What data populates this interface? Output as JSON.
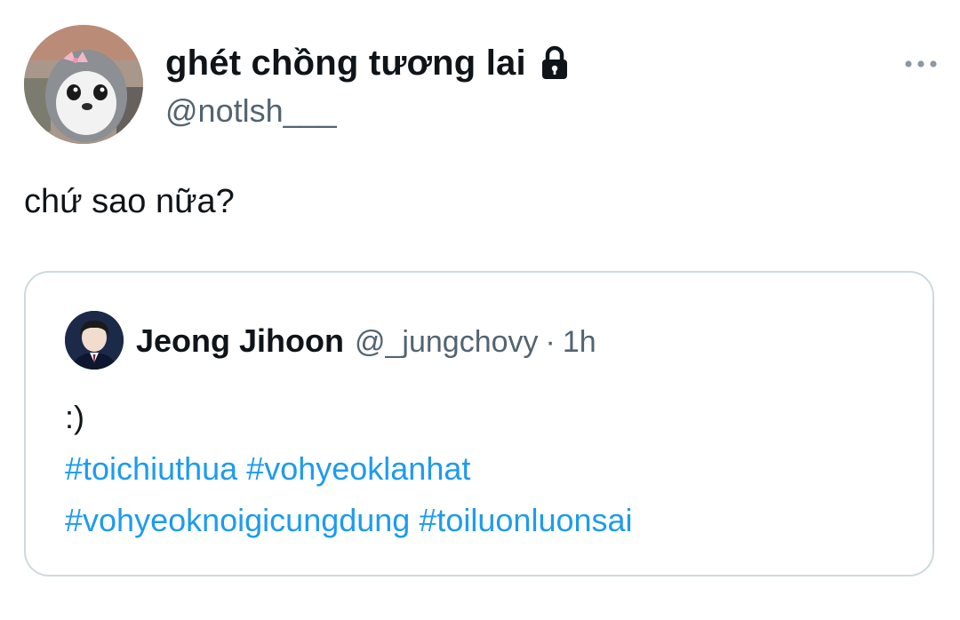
{
  "author": {
    "display_name": "ghét chồng tương lai",
    "handle": "@notlsh___",
    "avatar_icon": "penguin-avatar",
    "protected_icon": "lock-icon"
  },
  "menu_icon": "more-horizontal-icon",
  "tweet_text": "chứ sao nữa?",
  "quoted_tweet": {
    "display_name": "Jeong Jihoon",
    "handle": "@_jungchovy",
    "separator": "·",
    "time": "1h",
    "text_line": ":)",
    "hashtags_line1": [
      "#toichiuthua",
      "#vohyeoklanhat"
    ],
    "hashtags_line2": [
      "#vohyeoknoigicungdung",
      "#toiluonluonsai"
    ]
  },
  "colors": {
    "text": "#0f1419",
    "secondary": "#536471",
    "hashtag": "#1d9bf0",
    "border": "#cfd9de"
  }
}
